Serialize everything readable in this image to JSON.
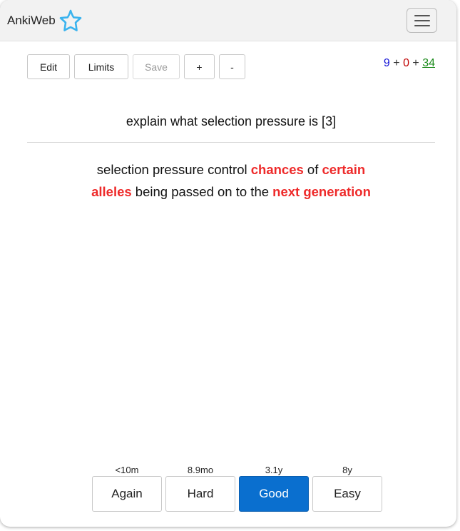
{
  "navbar": {
    "brand": "AnkiWeb",
    "logo_icon": "star-outline-icon",
    "menu_icon": "hamburger-menu-icon"
  },
  "toolbar": {
    "edit_label": "Edit",
    "limits_label": "Limits",
    "save_label": "Save",
    "plus_label": "+",
    "minus_label": "-"
  },
  "counts": {
    "new": "9",
    "sep1": " + ",
    "learning": "0",
    "sep2": " + ",
    "review": "34",
    "colors": {
      "new": "#1212d6",
      "learning": "#c00000",
      "review": "#1a8a1a"
    }
  },
  "card": {
    "question": "explain what selection pressure is [3]",
    "answer_parts": [
      {
        "text": "selection pressure control ",
        "highlight": false
      },
      {
        "text": "chances",
        "highlight": true
      },
      {
        "text": " of ",
        "highlight": false
      },
      {
        "text": "certain",
        "highlight": true
      },
      {
        "text": " ",
        "highlight": false
      },
      {
        "text": "alleles",
        "highlight": true
      },
      {
        "text": " being passed on to the ",
        "highlight": false
      },
      {
        "text": "next generation",
        "highlight": true
      }
    ],
    "highlight_color": "#ee2a2a"
  },
  "ease_buttons": [
    {
      "interval": "<10m",
      "label": "Again"
    },
    {
      "interval": "8.9mo",
      "label": "Hard"
    },
    {
      "interval": "3.1y",
      "label": "Good"
    },
    {
      "interval": "8y",
      "label": "Easy"
    }
  ],
  "accent_color": "#0a6fcf"
}
